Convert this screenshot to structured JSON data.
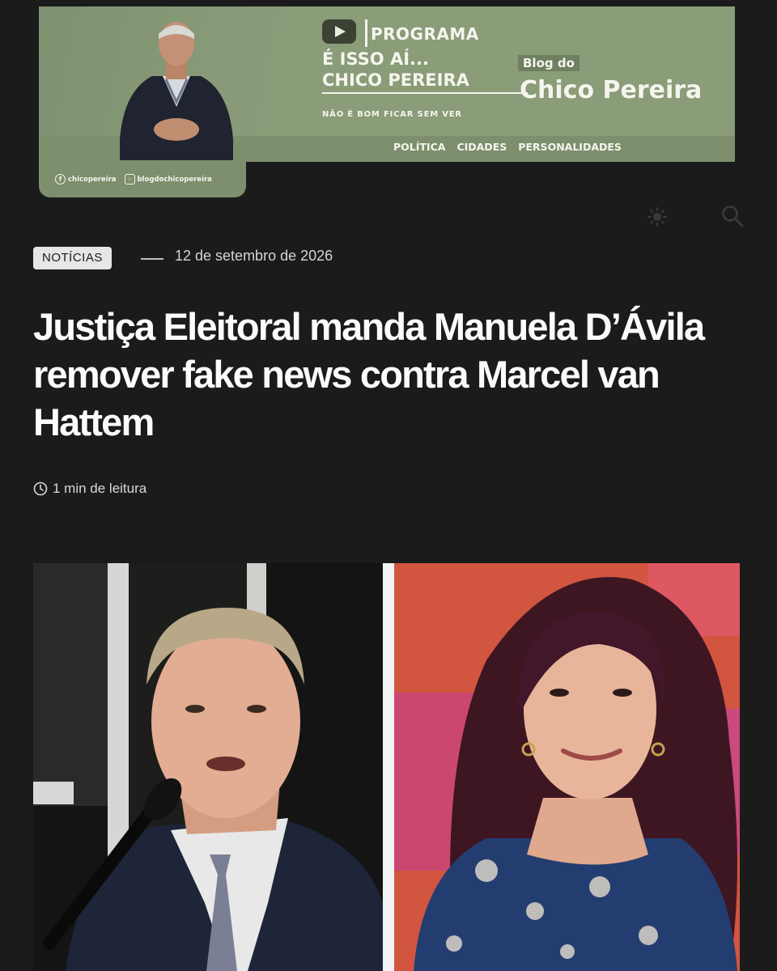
{
  "banner": {
    "program_label": "PROGRAMA",
    "program_title_line1": "É ISSO AÍ...",
    "program_title_line2": "CHICO PEREIRA",
    "program_tagline": "NÃO É BOM FICAR SEM VER",
    "blog_prefix": "Blog do",
    "blog_name": "Chico Pereira",
    "nav": [
      "POLÍTICA",
      "CIDADES",
      "PERSONALIDADES"
    ],
    "social": {
      "facebook": "chicopereira",
      "instagram": "blogdochicopereira"
    }
  },
  "toolbar": {
    "theme_icon": "sun-icon",
    "search_icon": "search-icon"
  },
  "article": {
    "category": "NOTÍCIAS",
    "date": "12 de setembro de 2026",
    "title": "Justiça Eleitoral manda Manuela D’Ávila remover fake news contra Marcel van Hattem",
    "read_time": "1 min de leitura",
    "read_time_icon": "clock-icon"
  },
  "colors": {
    "background": "#1b1b1b",
    "banner_green": "#8a9c78",
    "text": "#fbfbfb"
  }
}
